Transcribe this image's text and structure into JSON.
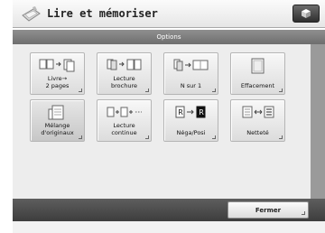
{
  "window": {
    "title": "Lire et mémoriser"
  },
  "options_bar": {
    "label": "Options"
  },
  "tiles": [
    {
      "label": "Livre→\n2 pages",
      "icon": "book-to-two-pages-icon"
    },
    {
      "label": "Lecture\nbrochure",
      "icon": "booklet-scan-icon"
    },
    {
      "label": "N sur 1",
      "icon": "n-on-1-icon"
    },
    {
      "label": "Effacement",
      "icon": "erase-frame-icon"
    },
    {
      "label": "Mélange\nd'originaux",
      "icon": "mixed-originals-icon"
    },
    {
      "label": "Lecture\ncontinue",
      "icon": "job-build-icon"
    },
    {
      "label": "Néga/Posi",
      "icon": "nega-posi-icon"
    },
    {
      "label": "Netteté",
      "icon": "sharpness-icon"
    }
  ],
  "footer": {
    "close_label": "Fermer"
  }
}
